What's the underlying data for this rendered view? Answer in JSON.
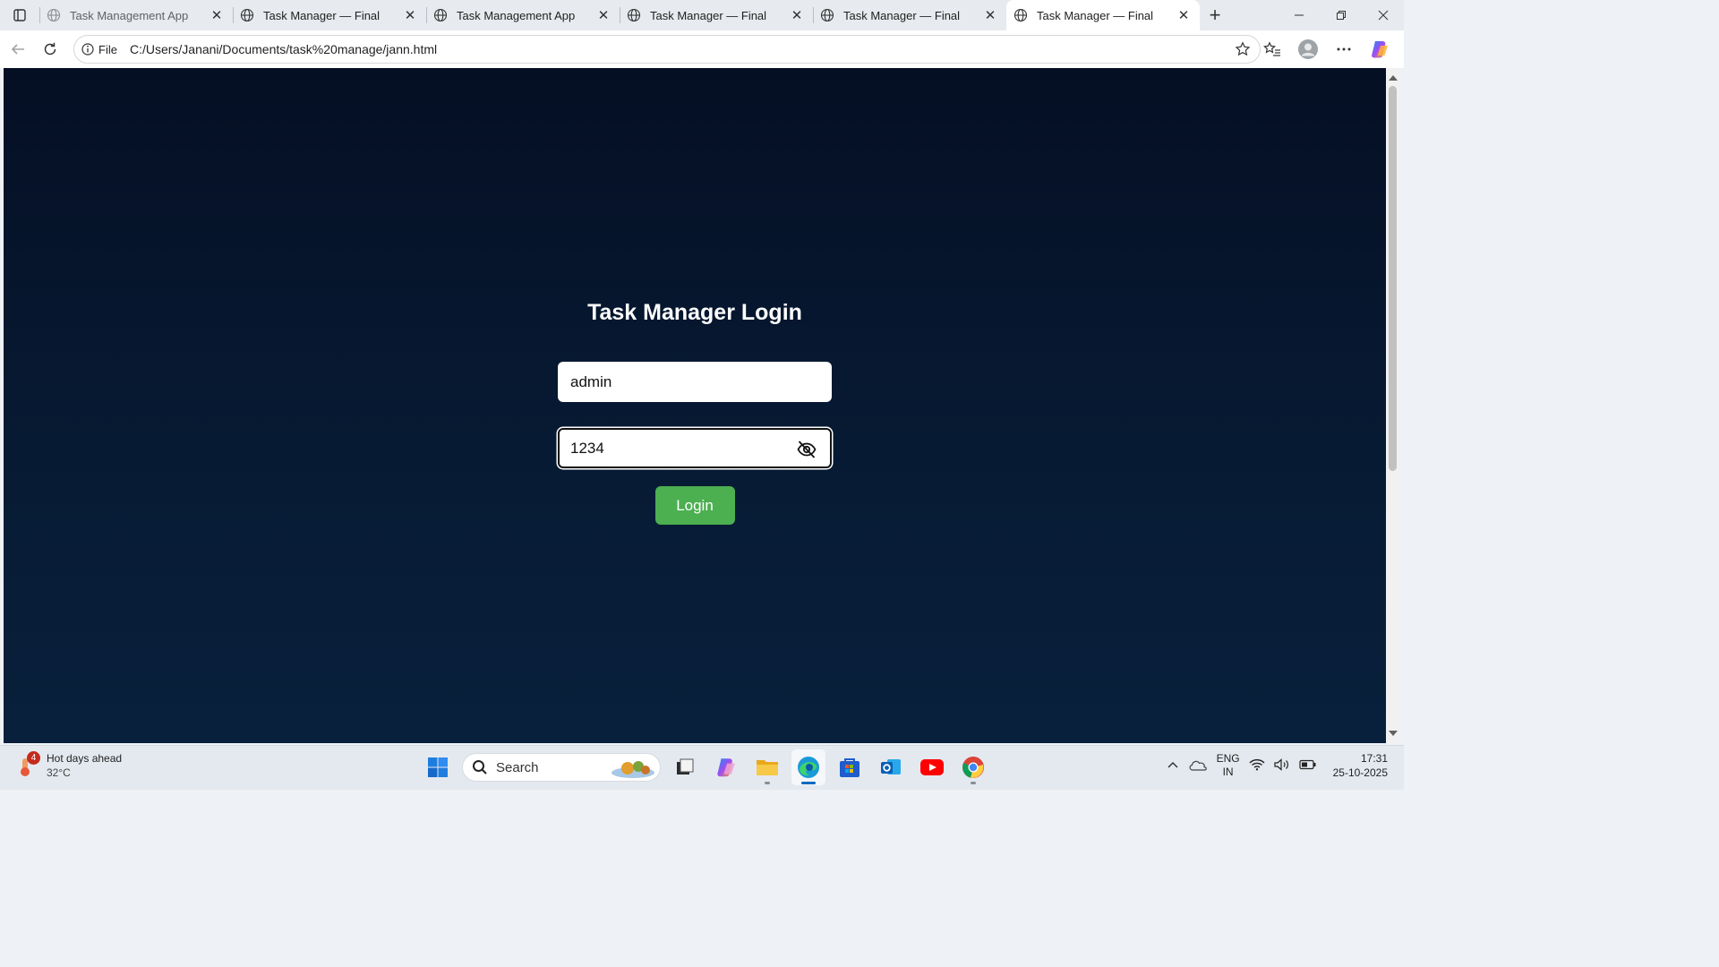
{
  "browser": {
    "tabs": [
      {
        "title": "Task Management App",
        "active": false,
        "dim": true
      },
      {
        "title": "Task Manager — Final",
        "active": false,
        "dim": false
      },
      {
        "title": "Task Management App",
        "active": false,
        "dim": false
      },
      {
        "title": "Task Manager — Final",
        "active": false,
        "dim": false
      },
      {
        "title": "Task Manager — Final",
        "active": false,
        "dim": false
      },
      {
        "title": "Task Manager — Final",
        "active": true,
        "dim": false
      }
    ],
    "address": {
      "scheme_label": "File",
      "url": "C:/Users/Janani/Documents/task%20manage/jann.html"
    }
  },
  "page": {
    "title": "Task Manager Login",
    "username_value": "admin",
    "password_value": "1234",
    "login_label": "Login",
    "login_color": "#4caf50"
  },
  "taskbar": {
    "weather": {
      "badge": "4",
      "headline": "Hot days ahead",
      "temp": "32°C"
    },
    "search_label": "Search",
    "lang_top": "ENG",
    "lang_bottom": "IN",
    "time": "17:31",
    "date": "25-10-2025"
  }
}
